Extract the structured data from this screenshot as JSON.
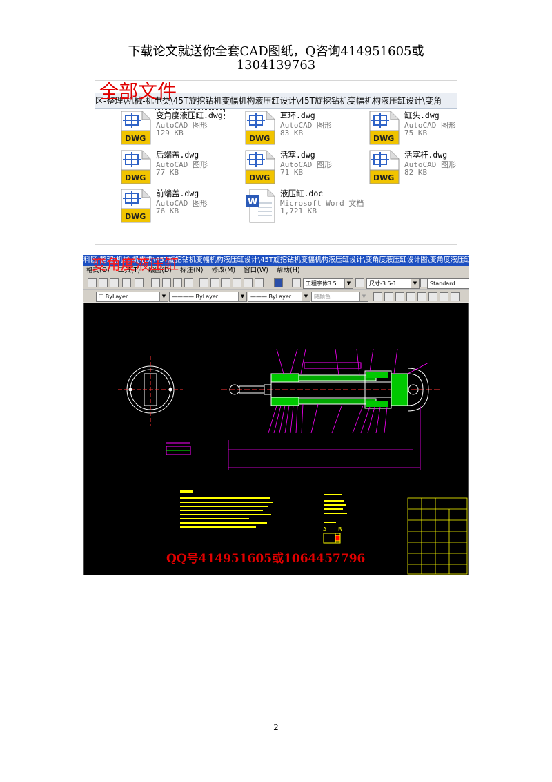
{
  "header": {
    "line1": "下载论文就送你全套CAD图纸，Q咨询414951605或",
    "line2": "1304139763"
  },
  "explorer": {
    "overlay_title": "全部文件",
    "path": "区-整理\\机械-机电类\\45T旋挖钻机变幅机构液压缸设计\\45T旋挖钻机变幅机构液压缸设计\\变角",
    "files": [
      {
        "name": "变角度液压缸.dwg",
        "type": "AutoCAD 图形",
        "size": "129 KB",
        "icon": "dwg-icon",
        "selected": true
      },
      {
        "name": "耳环.dwg",
        "type": "AutoCAD 图形",
        "size": "83 KB",
        "icon": "dwg-icon"
      },
      {
        "name": "缸头.dwg",
        "type": "AutoCAD 图形",
        "size": "75 KB",
        "icon": "dwg-icon"
      },
      {
        "name": "后端盖.dwg",
        "type": "AutoCAD 图形",
        "size": "77 KB",
        "icon": "dwg-icon"
      },
      {
        "name": "活塞.dwg",
        "type": "AutoCAD 图形",
        "size": "71 KB",
        "icon": "dwg-icon"
      },
      {
        "name": "活塞杆.dwg",
        "type": "AutoCAD 图形",
        "size": "82 KB",
        "icon": "dwg-icon"
      },
      {
        "name": "前端盖.dwg",
        "type": "AutoCAD 图形",
        "size": "76 KB",
        "icon": "dwg-icon"
      },
      {
        "name": "液压缸.doc",
        "type": "Microsoft Word 文档",
        "size": "1,721 KB",
        "icon": "word-doc-icon"
      }
    ],
    "dwg_badge": "DWG"
  },
  "cad": {
    "overlay_title": "变角度液压缸",
    "titlebar": "料区-整理\\机械-机电类\\45T旋挖钻机变幅机构液压缸设计\\45T旋挖钻机变幅机构液压缸设计\\变角度液压缸设计图\\变角度液压缸.dwg]",
    "menu": [
      "格式(O)",
      "工具(T)",
      "绘图(D)",
      "标注(N)",
      "修改(M)",
      "窗口(W)",
      "帮助(H)"
    ],
    "text_style": "工程字体3.5",
    "dim_style": "尺寸-3.5-1",
    "table_style": "Standard",
    "layer_color": "ByLayer",
    "linetype": "ByLayer",
    "lineweight": "ByLayer",
    "plot_style": "随颜色",
    "view_label_a": "A",
    "view_label_b": "B",
    "qq_text": "QQ号414951605或1064457796"
  },
  "page_number": "2",
  "colors": {
    "cad_background": "#000000",
    "overlay_red": "#e00000",
    "cad_magenta": "#ff00ff",
    "cad_green": "#00ff00",
    "cad_yellow": "#ffff00"
  }
}
